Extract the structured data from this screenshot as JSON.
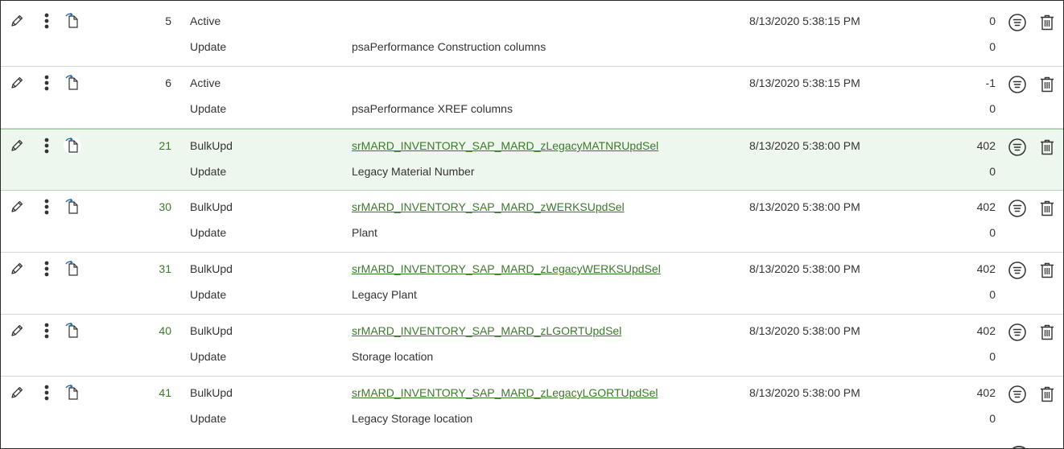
{
  "rows": [
    {
      "seq": "5",
      "kind": "Active",
      "desc1": "",
      "link": "",
      "ts": "8/13/2020 5:38:15 PM",
      "count": "0",
      "kind2": "Update",
      "desc2": "psaPerformance Construction columns",
      "count2": "0"
    },
    {
      "seq": "6",
      "kind": "Active",
      "desc1": "",
      "link": "",
      "ts": "8/13/2020 5:38:15 PM",
      "count": "-1",
      "kind2": "Update",
      "desc2": "psaPerformance XREF columns",
      "count2": "0"
    },
    {
      "seq": "21",
      "kind": "BulkUpd",
      "desc1": "",
      "link": "srMARD_INVENTORY_SAP_MARD_zLegacyMATNRUpdSel",
      "ts": "8/13/2020 5:38:00 PM",
      "count": "402",
      "kind2": "Update",
      "desc2": "Legacy Material Number",
      "count2": "0"
    },
    {
      "seq": "30",
      "kind": "BulkUpd",
      "desc1": "",
      "link": "srMARD_INVENTORY_SAP_MARD_zWERKSUpdSel",
      "ts": "8/13/2020 5:38:00 PM",
      "count": "402",
      "kind2": "Update",
      "desc2": "Plant",
      "count2": "0"
    },
    {
      "seq": "31",
      "kind": "BulkUpd",
      "desc1": "",
      "link": "srMARD_INVENTORY_SAP_MARD_zLegacyWERKSUpdSel",
      "ts": "8/13/2020 5:38:00 PM",
      "count": "402",
      "kind2": "Update",
      "desc2": "Legacy Plant",
      "count2": "0"
    },
    {
      "seq": "40",
      "kind": "BulkUpd",
      "desc1": "",
      "link": "srMARD_INVENTORY_SAP_MARD_zLGORTUpdSel",
      "ts": "8/13/2020 5:38:00 PM",
      "count": "402",
      "kind2": "Update",
      "desc2": "Storage location",
      "count2": "0"
    },
    {
      "seq": "41",
      "kind": "BulkUpd",
      "desc1": "",
      "link": "srMARD_INVENTORY_SAP_MARD_zLegacyLGORTUpdSel",
      "ts": "8/13/2020 5:38:00 PM",
      "count": "402",
      "kind2": "Update",
      "desc2": "Legacy Storage location",
      "count2": "0"
    }
  ],
  "row_icons": [
    "pencil-icon",
    "vertical-dots-icon",
    "document-arrow-icon",
    "list-circle-icon",
    "trash-icon"
  ],
  "selected_row_index": 2,
  "colors": {
    "link": "#3a7a2a",
    "selected_bg": "#eef7ee",
    "selected_border": "#9dc99d",
    "text": "#333333",
    "divider": "#d4d4d4"
  }
}
